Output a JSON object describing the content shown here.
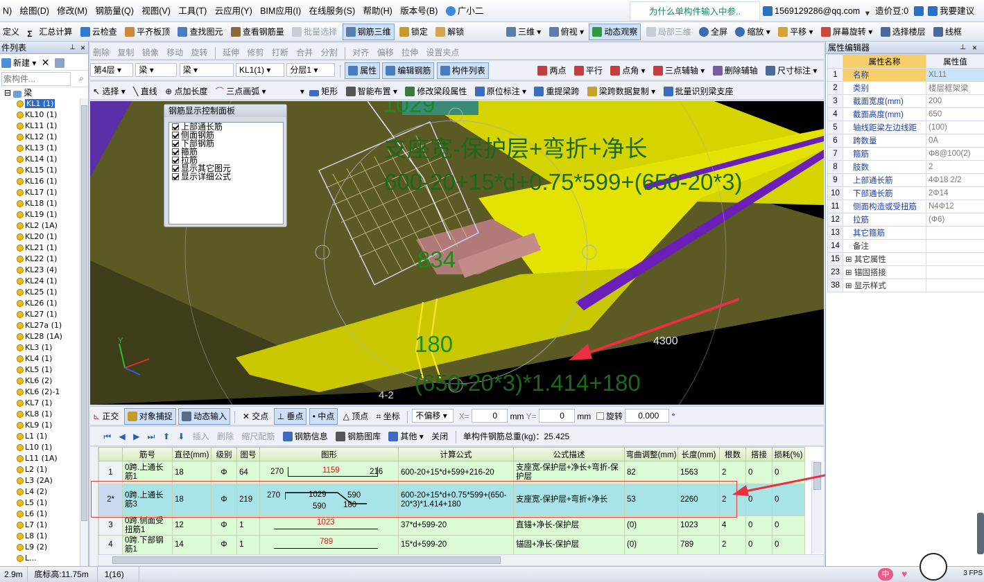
{
  "menu": [
    "N)",
    "绘图(D)",
    "修改(M)",
    "钢筋量(Q)",
    "视图(V)",
    "工具(T)",
    "云应用(Y)",
    "BIM应用(I)",
    "在线服务(S)",
    "帮助(H)",
    "版本号(B)",
    "广小二"
  ],
  "notice": "为什么单构件输入中参..",
  "account": {
    "email": "1569129286@qq.com",
    "coins": "造价豆:0",
    "suggest": "我要建议"
  },
  "toolbar1": {
    "left": [
      "定义",
      "汇总计算",
      "云检查",
      "平齐板顶",
      "查找图元",
      "查看钢筋量",
      "批量选择",
      "钢筋三维",
      "锁定",
      "解锁"
    ],
    "right": [
      "三维",
      "俯视",
      "动态观察",
      "局部三维",
      "全屏",
      "缩放",
      "平移",
      "屏幕旋转",
      "选择楼层",
      "线框"
    ]
  },
  "left_panel": {
    "title": "件列表",
    "new_btn": "新建",
    "search_placeholder": "索构件...",
    "root": "梁",
    "items": [
      "KL1 (1)",
      "KL10 (1)",
      "KL11 (1)",
      "KL12 (1)",
      "KL13 (1)",
      "KL14 (1)",
      "KL15 (1)",
      "KL16 (1)",
      "KL17 (1)",
      "KL18 (1)",
      "KL19 (1)",
      "KL2 (1A)",
      "KL20 (1)",
      "KL21 (1)",
      "KL22 (1)",
      "KL23 (4)",
      "KL24 (1)",
      "KL25 (1)",
      "KL26 (1)",
      "KL27 (1)",
      "KL27a (1)",
      "KL28 (1A)",
      "KL3 (1)",
      "KL4 (1)",
      "KL5 (1)",
      "KL6 (2)",
      "KL6 (2)-1",
      "KL7 (1)",
      "KL8 (1)",
      "KL9 (1)",
      "L1 (1)",
      "L10 (1)",
      "L11 (1A)",
      "L2 (1)",
      "L3 (2A)",
      "L4 (2)",
      "L5 (1)",
      "L6 (1)",
      "L7 (1)",
      "L8 (1)",
      "L9 (2)",
      "L..."
    ]
  },
  "toolbar2": [
    "删除",
    "复制",
    "镜像",
    "移动",
    "旋转",
    "延伸",
    "修剪",
    "打断",
    "合并",
    "分割",
    "对齐",
    "偏移",
    "拉伸",
    "设置夹点"
  ],
  "toolbar3": {
    "combos": [
      "第4层",
      "梁",
      "梁",
      "KL1(1)",
      "分层1"
    ],
    "buttons": [
      "属性",
      "编辑钢筋",
      "构件列表"
    ],
    "right": [
      "两点",
      "平行",
      "点角",
      "三点辅轴",
      "删除辅轴",
      "尺寸标注"
    ]
  },
  "toolbar4": [
    "选择",
    "直线",
    "点加长度",
    "三点画弧",
    "矩形",
    "智能布置",
    "修改梁段属性",
    "原位标注",
    "重提梁跨",
    "梁跨数据复制",
    "批量识别梁支座"
  ],
  "control_panel": {
    "title": "钢筋显示控制面板",
    "items": [
      "上部通长筋",
      "侧面钢筋",
      "下部钢筋",
      "箍筋",
      "拉筋",
      "显示其它图元",
      "显示详细公式"
    ]
  },
  "viewport_text": {
    "t1029": "1029",
    "desc": "支座宽-保护层+弯折+净长",
    "formula": "600-20+15*d+0.75*599+(650-20*3)",
    "t834": "834",
    "t180": "180",
    "formula2": "(650-20*3)*1.414+180",
    "t4300": "4300",
    "t42": "4-2",
    "axis_y": "Y"
  },
  "snapbar": {
    "buttons": [
      "正交",
      "对象捕捉",
      "动态输入",
      "交点",
      "垂点",
      "中点",
      "顶点",
      "坐标"
    ],
    "offset_mode": "不偏移",
    "x_label": "X=",
    "x_val": "0",
    "y_label": "Y=",
    "y_val": "0",
    "unit": "mm",
    "rotate_label": "旋转",
    "rotate_val": "0.000",
    "deg": "°"
  },
  "gridbar": {
    "buttons": [
      "插入",
      "删除",
      "缩尺配筋",
      "钢筋信息",
      "钢筋图库",
      "其他",
      "关闭"
    ],
    "total": "单构件钢筋总重(kg)：25.425"
  },
  "grid": {
    "headers": [
      "筋号",
      "直径(mm)",
      "级别",
      "图号",
      "图形",
      "计算公式",
      "公式描述",
      "弯曲调整(mm)",
      "长度(mm)",
      "根数",
      "搭接",
      "损耗(%)"
    ],
    "rows": [
      {
        "idx": "1",
        "name": "0跨.上通长筋1",
        "dia": "18",
        "grade": "Φ",
        "fig": "64",
        "s1": "270",
        "s2": "1159",
        "s3": "216",
        "formula": "600-20+15*d+599+216-20",
        "desc": "支座宽-保护层+净长+弯折-保护层",
        "bend": "82",
        "len": "1563",
        "count": "2",
        "lap": "0",
        "loss": "0"
      },
      {
        "idx": "2*",
        "name": "0跨.上通长筋3",
        "dia": "18",
        "grade": "Φ",
        "fig": "219",
        "s1": "270",
        "s2": "1029",
        "s3": "590",
        "s4": "590",
        "s5": "180",
        "formula": "600-20+15*d+0.75*599+(650-20*3)*1.414+180",
        "desc": "支座宽-保护层+弯折+净长",
        "bend": "53",
        "len": "2260",
        "count": "2",
        "lap": "0",
        "loss": "0"
      },
      {
        "idx": "3",
        "name": "0跨.侧面受扭筋1",
        "dia": "12",
        "grade": "Φ",
        "fig": "1",
        "s2": "1023",
        "formula": "37*d+599-20",
        "desc": "直锚+净长-保护层",
        "bend": "(0)",
        "len": "1023",
        "count": "4",
        "lap": "0",
        "loss": "0"
      },
      {
        "idx": "4",
        "name": "0跨.下部钢筋1",
        "dia": "14",
        "grade": "Φ",
        "fig": "1",
        "s2": "789",
        "formula": "15*d+599-20",
        "desc": "锚固+净长-保护层",
        "bend": "(0)",
        "len": "789",
        "count": "2",
        "lap": "0",
        "loss": "0"
      }
    ]
  },
  "props": {
    "title": "属性编辑器",
    "col_name": "属性名称",
    "col_val": "属性值",
    "rows": [
      {
        "n": "1",
        "k": "名称",
        "v": "XL11"
      },
      {
        "n": "2",
        "k": "类别",
        "v": "楼层框架梁"
      },
      {
        "n": "3",
        "k": "截面宽度(mm)",
        "v": "200"
      },
      {
        "n": "4",
        "k": "截面高度(mm)",
        "v": "650"
      },
      {
        "n": "5",
        "k": "轴线距梁左边线距",
        "v": "(100)"
      },
      {
        "n": "6",
        "k": "跨数量",
        "v": "0A"
      },
      {
        "n": "7",
        "k": "箍筋",
        "v": "Φ8@100(2)"
      },
      {
        "n": "8",
        "k": "肢数",
        "v": "2"
      },
      {
        "n": "9",
        "k": "上部通长筋",
        "v": "4Φ18 2/2"
      },
      {
        "n": "10",
        "k": "下部通长筋",
        "v": "2Φ14"
      },
      {
        "n": "11",
        "k": "侧面构造或受扭筋",
        "v": "N4Φ12"
      },
      {
        "n": "12",
        "k": "拉筋",
        "v": "(Φ6)"
      },
      {
        "n": "13",
        "k": "其它箍筋",
        "v": ""
      },
      {
        "n": "14",
        "k": "备注",
        "v": ""
      },
      {
        "n": "15",
        "k": "其它属性",
        "v": ""
      },
      {
        "n": "23",
        "k": "锚固搭接",
        "v": ""
      },
      {
        "n": "38",
        "k": "显示样式",
        "v": ""
      }
    ]
  },
  "status": {
    "s1": "2.9m",
    "s2": "底标高:11.75m",
    "s3": "1(16)",
    "fps": "3 FPS"
  },
  "colors": {
    "accent": "#316ac5",
    "selected_row": "#a8e3e8",
    "grid_row": "#dcfad6",
    "red_arrow": "#e83040",
    "green_text": "#1c8a1c"
  }
}
